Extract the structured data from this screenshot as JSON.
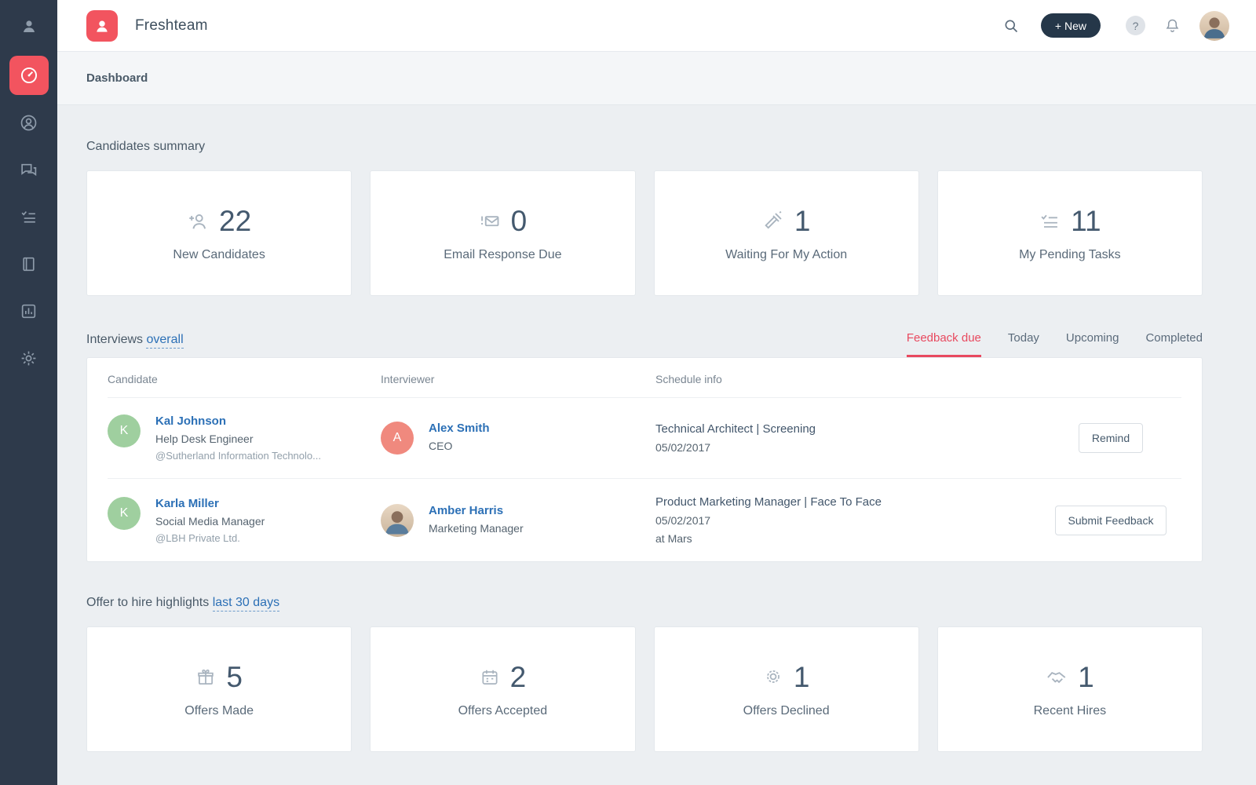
{
  "app": {
    "name": "Freshteam",
    "breadcrumb": "Dashboard"
  },
  "header": {
    "new_button_label": "+ New",
    "help_label": "?"
  },
  "sidebar": {
    "items": [
      "user",
      "dashboard",
      "candidates",
      "conversations",
      "tasks",
      "job-postings",
      "reports",
      "settings"
    ],
    "active_item": "dashboard"
  },
  "candidates_summary": {
    "title": "Candidates summary",
    "cards": [
      {
        "icon": "add-candidate-icon",
        "value": "22",
        "label": "New Candidates"
      },
      {
        "icon": "email-alert-icon",
        "value": "0",
        "label": "Email Response Due"
      },
      {
        "icon": "gavel-icon",
        "value": "1",
        "label": "Waiting For My Action"
      },
      {
        "icon": "checklist-icon",
        "value": "11",
        "label": "My Pending Tasks"
      }
    ]
  },
  "interviews": {
    "title": "Interviews",
    "scope_link": "overall",
    "tabs": [
      "Feedback due",
      "Today",
      "Upcoming",
      "Completed"
    ],
    "active_tab": "Feedback due",
    "columns": {
      "candidate": "Candidate",
      "interviewer": "Interviewer",
      "schedule": "Schedule info"
    },
    "rows": [
      {
        "candidate_initial": "K",
        "candidate_name": "Kal Johnson",
        "candidate_role": "Help Desk Engineer",
        "candidate_company": "@Sutherland Information Technolo...",
        "interviewer_initial": "A",
        "interviewer_name": "Alex Smith",
        "interviewer_role": "CEO",
        "schedule_line1": "Technical Architect | Screening",
        "schedule_line2": "05/02/2017",
        "schedule_line3": "",
        "action_label": "Remind"
      },
      {
        "candidate_initial": "K",
        "candidate_name": "Karla Miller",
        "candidate_role": "Social Media Manager",
        "candidate_company": "@LBH Private Ltd.",
        "interviewer_initial": "",
        "interviewer_name": "Amber Harris",
        "interviewer_role": "Marketing Manager",
        "schedule_line1": "Product Marketing Manager | Face To Face",
        "schedule_line2": "05/02/2017",
        "schedule_line3": "at Mars",
        "action_label": "Submit Feedback"
      }
    ]
  },
  "offers": {
    "title": "Offer to hire highlights",
    "scope_link": "last 30 days",
    "cards": [
      {
        "icon": "gift-icon",
        "value": "5",
        "label": "Offers Made"
      },
      {
        "icon": "calendar-icon",
        "value": "2",
        "label": "Offers Accepted"
      },
      {
        "icon": "badge-icon",
        "value": "1",
        "label": "Offers Declined"
      },
      {
        "icon": "handshake-icon",
        "value": "1",
        "label": "Recent Hires"
      }
    ]
  },
  "colors": {
    "brand_red": "#f2545f",
    "sidebar_navy": "#2e3a4b",
    "link_blue": "#2c70b6",
    "tab_active_red": "#e8495f",
    "avatar_green": "#9fcf9f",
    "avatar_salmon": "#f0897e",
    "stat_number": "#44596e"
  }
}
